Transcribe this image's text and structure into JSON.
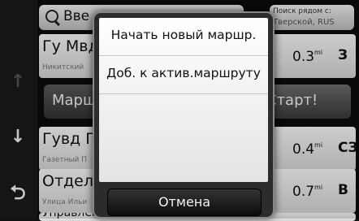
{
  "search": {
    "text": "Вве"
  },
  "near_box": {
    "line1": "Поиск рядом с:",
    "line2": "Тверской, RUS"
  },
  "rows": [
    {
      "name": "Гу Мвд",
      "sub": "Никитский",
      "distance": "0.3",
      "unit": "mi",
      "direction": "З"
    },
    {
      "name": "Гувд Г",
      "sub": "Газетный П",
      "distance": "0.4",
      "unit": "mi",
      "direction": "СЗ"
    },
    {
      "name": "Отдел",
      "sub": "Улица Ильи",
      "distance": "0.7",
      "unit": "mi",
      "direction": "В"
    },
    {
      "name": "Управление Внутр"
    }
  ],
  "route_button": {
    "label": "Марш"
  },
  "start_button": {
    "label": "Старт!"
  },
  "popup": {
    "items": [
      "Начать новый маршр.",
      "Доб. к актив.маршруту"
    ],
    "cancel_label": "Отмена"
  },
  "icons": {
    "scroll_up": "arrow-up-icon",
    "scroll_down": "arrow-down-icon",
    "back": "back-icon",
    "search": "search-icon"
  },
  "colors": {
    "popup_border": "#888888",
    "button_dark": "#0d0d0d"
  }
}
